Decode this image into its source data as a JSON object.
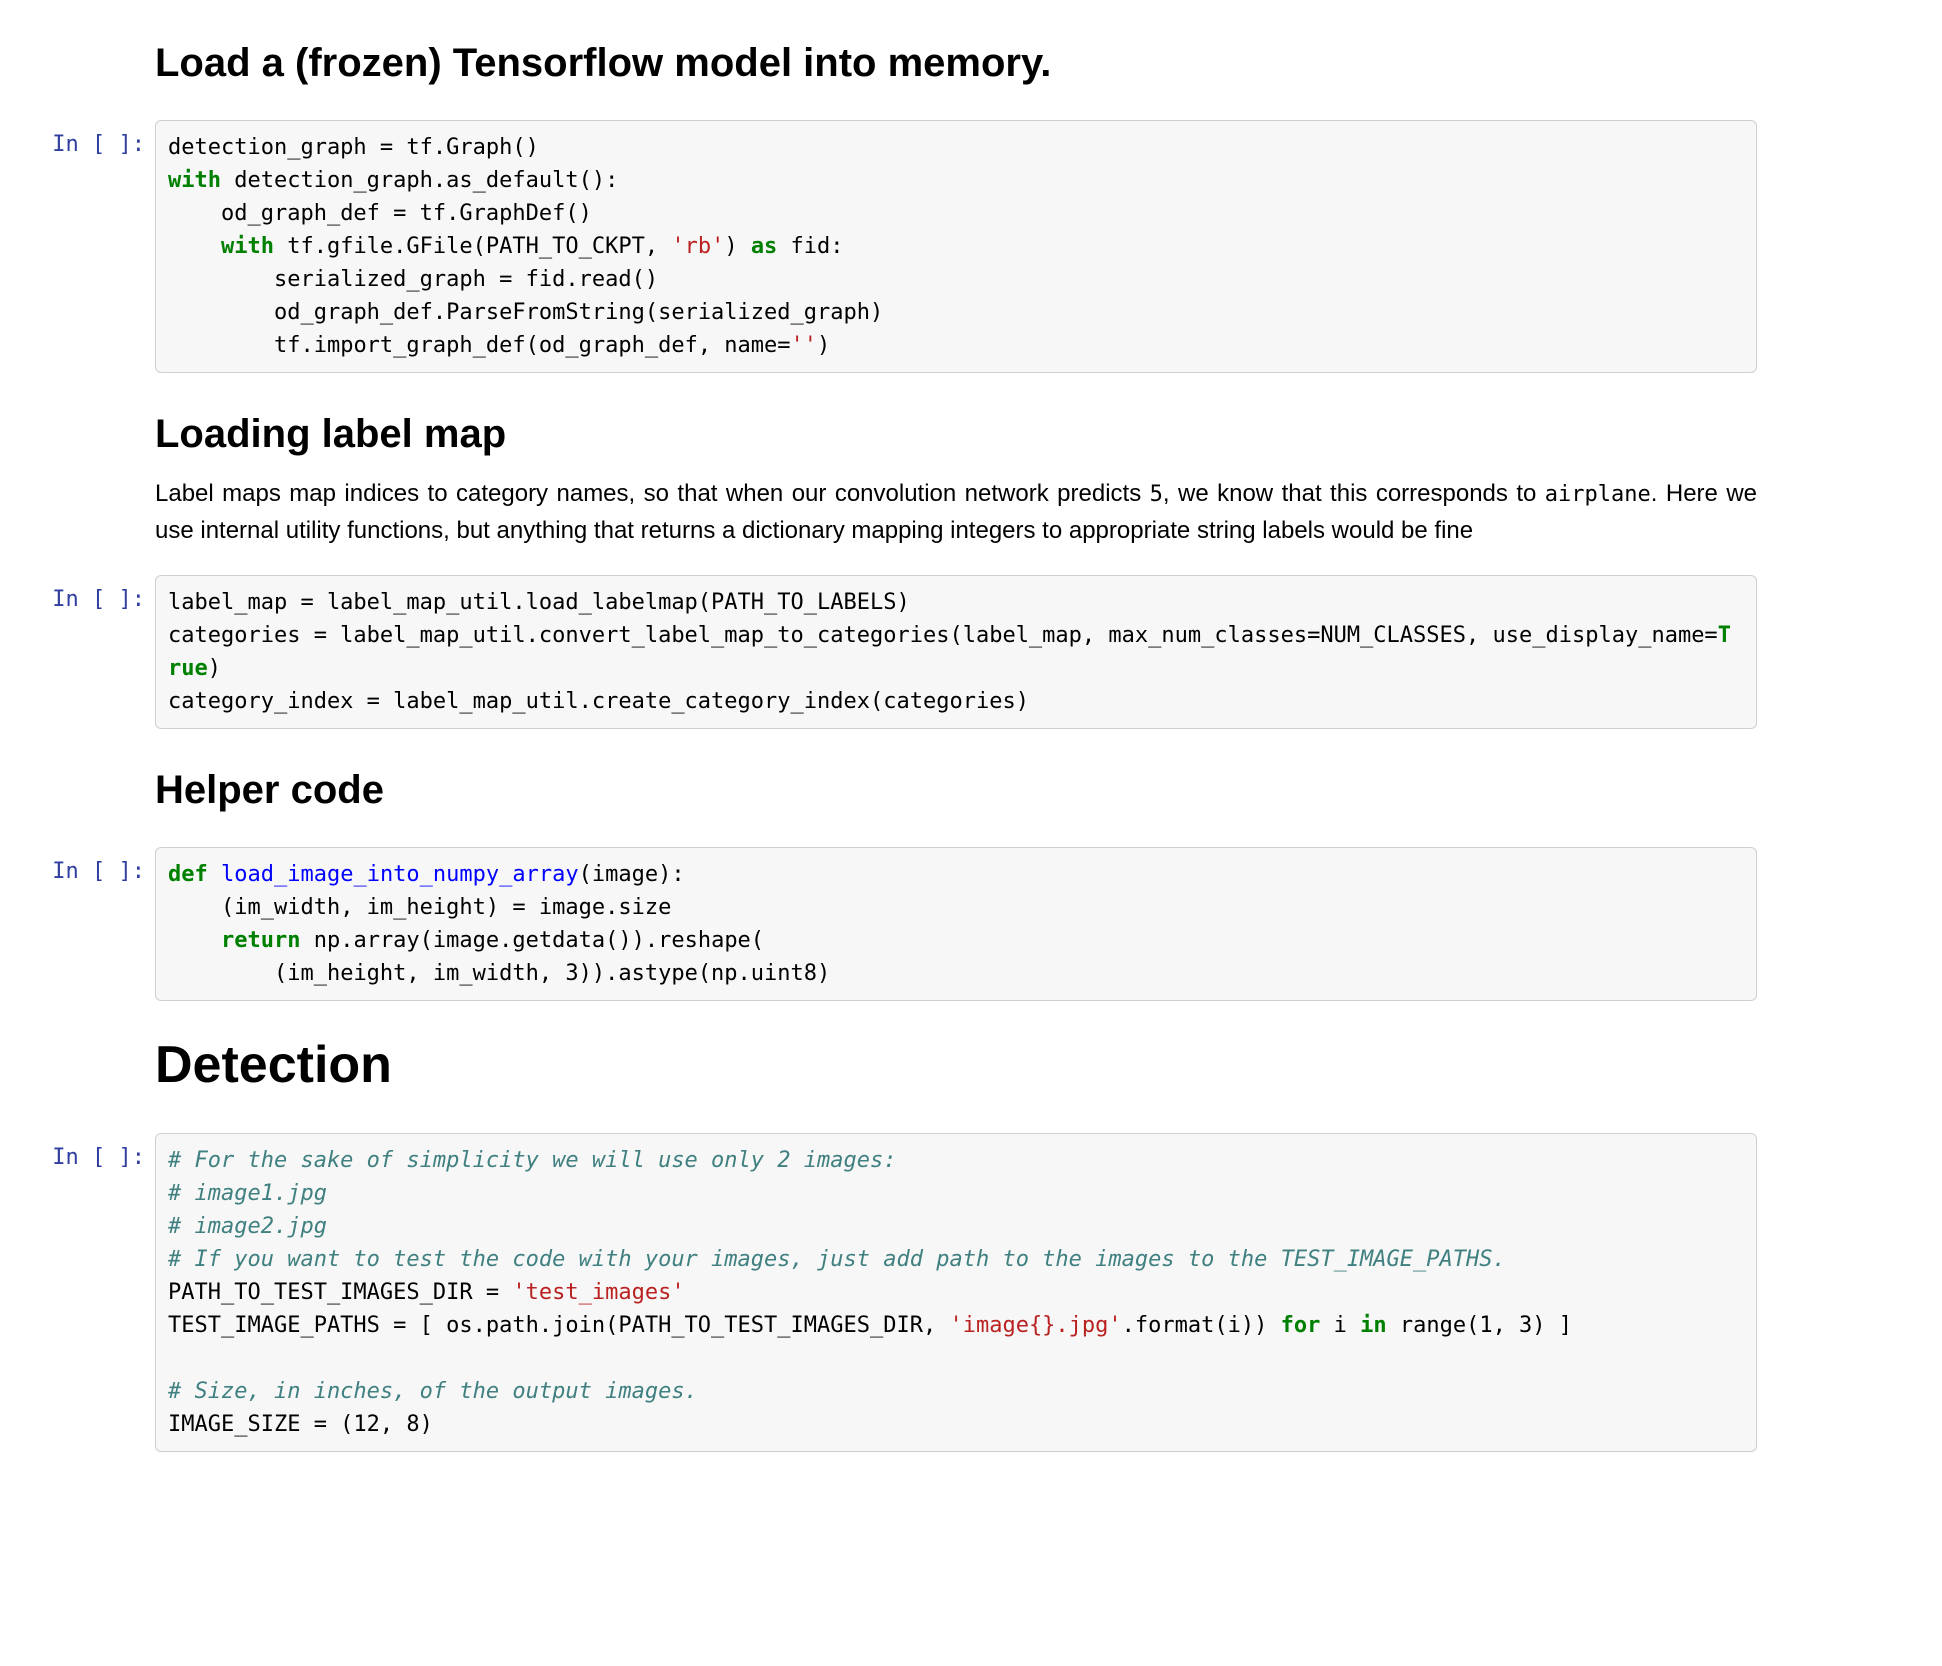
{
  "cells": {
    "headings": {
      "h1": "Load a (frozen) Tensorflow model into memory.",
      "h2": "Loading label map",
      "h3": "Helper code",
      "h4": "Detection"
    },
    "paragraphs": {
      "p1_a": "Label maps map indices to category names, so that when our convolution network predicts ",
      "p1_code1": "5",
      "p1_b": ", we know that this corresponds to ",
      "p1_code2": "airplane",
      "p1_c": ". Here we use internal utility functions, but anything that returns a dictionary mapping integers to appropriate string labels would be fine"
    },
    "prompts": {
      "in_empty": "In [ ]:"
    },
    "code1": {
      "l1_a": "detection_graph = tf.Graph()",
      "l2_kw": "with",
      "l2_rest": " detection_graph.as_default():",
      "l3": "    od_graph_def = tf.GraphDef()",
      "l4_a": "    ",
      "l4_kw": "with",
      "l4_b": " tf.gfile.GFile(PATH_TO_CKPT, ",
      "l4_str": "'rb'",
      "l4_c": ") ",
      "l4_as": "as",
      "l4_d": " fid:",
      "l5": "        serialized_graph = fid.read()",
      "l6": "        od_graph_def.ParseFromString(serialized_graph)",
      "l7_a": "        tf.import_graph_def(od_graph_def, name=",
      "l7_str": "''",
      "l7_b": ")"
    },
    "code2": {
      "l1": "label_map = label_map_util.load_labelmap(PATH_TO_LABELS)",
      "l2_a": "categories = label_map_util.convert_label_map_to_categories(label_map, max_num_classes=NUM_CLASSES, use_display_name=",
      "l2_bool": "True",
      "l2_b": ")",
      "l3": "category_index = label_map_util.create_category_index(categories)"
    },
    "code3": {
      "l1_kw": "def",
      "l1_sp": " ",
      "l1_fn": "load_image_into_numpy_array",
      "l1_rest": "(image):",
      "l2": "    (im_width, im_height) = image.size",
      "l3_a": "    ",
      "l3_kw": "return",
      "l3_b": " np.array(image.getdata()).reshape(",
      "l4": "        (im_height, im_width, 3)).astype(np.uint8)"
    },
    "code4": {
      "c1": "# For the sake of simplicity we will use only 2 images:",
      "c2": "# image1.jpg",
      "c3": "# image2.jpg",
      "c4": "# If you want to test the code with your images, just add path to the images to the TEST_IMAGE_PATHS.",
      "l5_a": "PATH_TO_TEST_IMAGES_DIR = ",
      "l5_str": "'test_images'",
      "l6_a": "TEST_IMAGE_PATHS = [ os.path.join(PATH_TO_TEST_IMAGES_DIR, ",
      "l6_str": "'image{}.jpg'",
      "l6_b": ".format(i)) ",
      "l6_for": "for",
      "l6_c": " i ",
      "l6_in": "in",
      "l6_d": " range(1, 3) ]",
      "blank": "",
      "c5": "# Size, in inches, of the output images.",
      "l8": "IMAGE_SIZE = (12, 8)"
    }
  }
}
